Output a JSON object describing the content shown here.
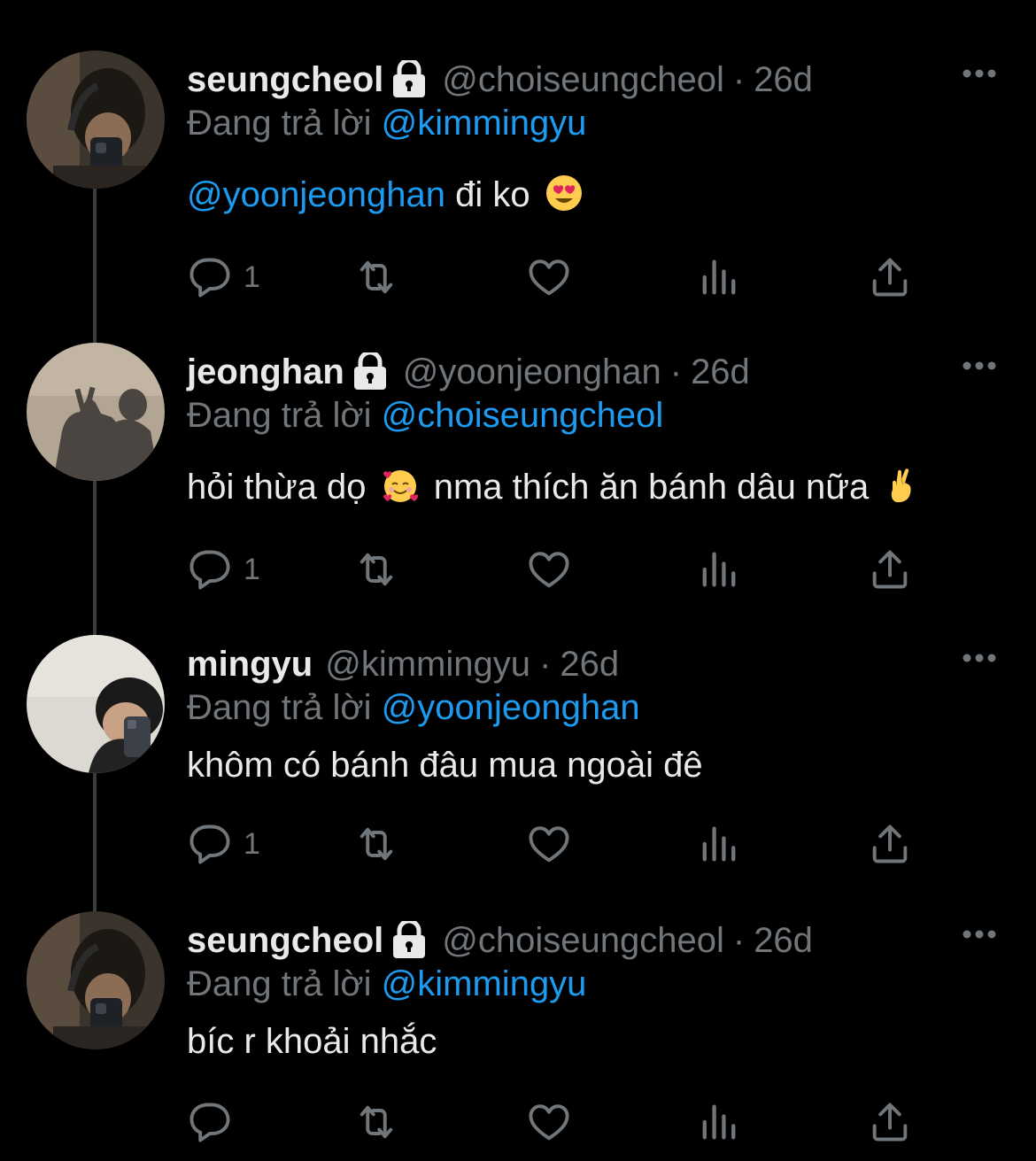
{
  "colors": {
    "background": "#000000",
    "text": "#e7e9ea",
    "muted": "#71767b",
    "mention": "#1d9bf0",
    "thread_line": "#3a3d40"
  },
  "tweets": [
    {
      "name": "seungcheol",
      "protected": true,
      "handle": "@choiseungcheol",
      "separator": "·",
      "time": "26d",
      "reply_prefix": "Đang trả lời",
      "reply_to": "@kimmingyu",
      "body_mention": "@yoonjeonghan",
      "body_text": " đi ko",
      "body_emoji": "smiling-face-with-heart-eyes-emoji",
      "reply_count": "1",
      "icons": [
        "reply-icon",
        "retweet-icon",
        "like-icon",
        "views-icon",
        "share-icon",
        "more-icon",
        "lock-icon"
      ]
    },
    {
      "name": "jeonghan",
      "protected": true,
      "handle": "@yoonjeonghan",
      "separator": "·",
      "time": "26d",
      "reply_prefix": "Đang trả lời",
      "reply_to": "@choiseungcheol",
      "body_text_1": "hỏi thừa dọ",
      "body_emoji_1": "smiling-face-with-hearts-emoji",
      "body_text_2": " nma thích ăn bánh dâu nữa",
      "body_emoji_2": "crossed-fingers-emoji",
      "reply_count": "1"
    },
    {
      "name": "mingyu",
      "protected": false,
      "handle": "@kimmingyu",
      "separator": "·",
      "time": "26d",
      "reply_prefix": "Đang trả lời",
      "reply_to": "@yoonjeonghan",
      "body_text": "khôm có bánh đâu mua ngoài đê",
      "reply_count": "1"
    },
    {
      "name": "seungcheol",
      "protected": true,
      "handle": "@choiseungcheol",
      "separator": "·",
      "time": "26d",
      "reply_prefix": "Đang trả lời",
      "reply_to": "@kimmingyu",
      "body_text": "bíc r khoải nhắc",
      "reply_count": ""
    }
  ]
}
